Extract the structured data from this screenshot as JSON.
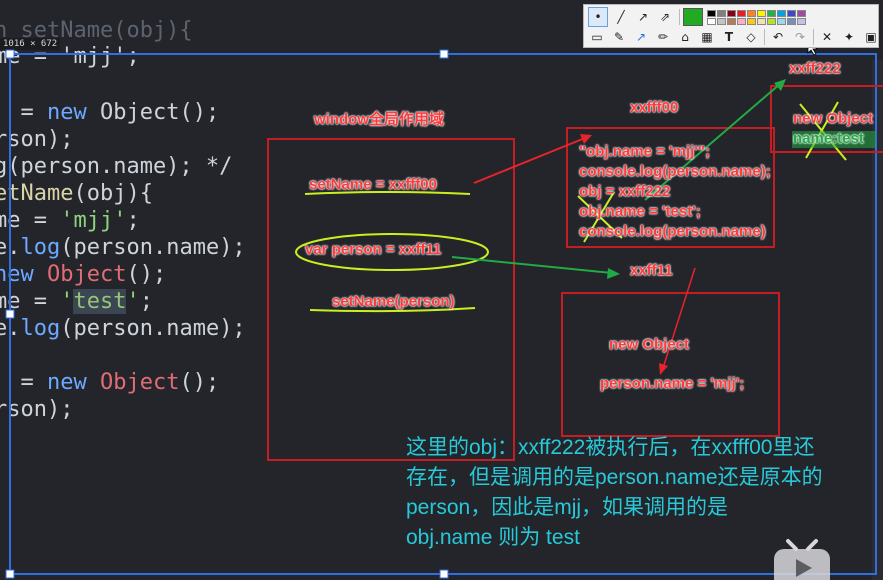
{
  "window": {
    "size_label": "1016 × 672"
  },
  "code_lines": [
    {
      "id": "l1",
      "text_parts": [
        {
          "t": "n setName(obj){",
          "c": "dim"
        }
      ]
    },
    {
      "id": "l2",
      "text_parts": [
        {
          "t": "me = 'mjj';",
          "c": ""
        }
      ]
    },
    {
      "id": "l3",
      "text_parts": [
        {
          "t": "  = ",
          "c": ""
        },
        {
          "t": "new ",
          "c": "kw"
        },
        {
          "t": "Object",
          "c": ""
        },
        {
          "t": "();",
          "c": ""
        }
      ]
    },
    {
      "id": "l4",
      "text_parts": [
        {
          "t": "rson);",
          "c": ""
        }
      ]
    },
    {
      "id": "l5",
      "text_parts": [
        {
          "t": "g(person.name); */",
          "c": ""
        }
      ]
    },
    {
      "id": "l6",
      "text_parts": [
        {
          "t": "etName",
          "c": "fn"
        },
        {
          "t": "(obj){",
          "c": ""
        }
      ]
    },
    {
      "id": "l7",
      "text_parts": [
        {
          "t": "me = ",
          "c": ""
        },
        {
          "t": "'mjj'",
          "c": "str"
        },
        {
          "t": ";",
          "c": ""
        }
      ]
    },
    {
      "id": "l8",
      "text_parts": [
        {
          "t": "e.",
          "c": ""
        },
        {
          "t": "log",
          "c": "kw"
        },
        {
          "t": "(person.name);",
          "c": ""
        }
      ]
    },
    {
      "id": "l9",
      "text_parts": [
        {
          "t": "new ",
          "c": "kw"
        },
        {
          "t": "Object",
          "c": "cls"
        },
        {
          "t": "();",
          "c": ""
        }
      ]
    },
    {
      "id": "l10",
      "text_parts": [
        {
          "t": "me = ",
          "c": ""
        },
        {
          "t": "'",
          "c": "str"
        },
        {
          "t": "test",
          "c": "sel"
        },
        {
          "t": "'",
          "c": "str"
        },
        {
          "t": ";",
          "c": ""
        }
      ]
    },
    {
      "id": "l11",
      "text_parts": [
        {
          "t": "e.",
          "c": ""
        },
        {
          "t": "log",
          "c": "kw"
        },
        {
          "t": "(person.name);",
          "c": ""
        }
      ]
    },
    {
      "id": "l12",
      "text_parts": [
        {
          "t": "  = ",
          "c": ""
        },
        {
          "t": "new ",
          "c": "kw"
        },
        {
          "t": "Object",
          "c": "cls"
        },
        {
          "t": "();",
          "c": ""
        }
      ]
    },
    {
      "id": "l13",
      "text_parts": [
        {
          "t": "rson);",
          "c": ""
        }
      ]
    }
  ],
  "annotations": {
    "scope_title": "window全局作用域",
    "set_name_assign": "setName = xxfff00",
    "var_person": "var person = xxff11",
    "set_name_call": "setName(person)",
    "addr_fff00": "xxfff00",
    "fn_body": [
      "\"obj.name = 'mjj'\";",
      "console.log(person.name);",
      "obj = xxff222",
      "obj.name = 'test';",
      "console.log(person.name)"
    ],
    "addr_ff11": "xxff11",
    "new_object_1": "new Object",
    "person_name": "person.name = 'mjj';",
    "addr_ff222": "xxff222",
    "new_object_2": "new Object",
    "name_test": "name:test"
  },
  "note_lines": [
    "这里的obj：xxff222被执行后，在xxfff00里还",
    "存在，但是调用的是person.name还是原本的",
    "person，因此是mjj，如果调用的是",
    "obj.name 则为 test"
  ],
  "toolbar": {
    "row1": [
      "dot-tool",
      "line-tool",
      "arrow-tool",
      "arrow-outline-tool"
    ],
    "row2": [
      "rect-select-tool",
      "pen-tool",
      "arrow-tool",
      "pencil-tool",
      "marker-tool",
      "blur-tool",
      "text-tool",
      "eraser-tool",
      "undo",
      "redo",
      "close",
      "pin",
      "save",
      "copy"
    ],
    "selected_color": "#22aa22",
    "palette": [
      "#000000",
      "#7f7f7f",
      "#880015",
      "#ed1c24",
      "#ff7f27",
      "#fff200",
      "#22b14c",
      "#00a2e8",
      "#3f48cc",
      "#a349a4",
      "#ffffff",
      "#c3c3c3",
      "#b97a57",
      "#ffaec9",
      "#ffc90e",
      "#efe4b0",
      "#b5e61d",
      "#99d9ea",
      "#7092be",
      "#c8bfe7"
    ]
  },
  "colors": {
    "annotation_red": "#e8232a",
    "annotation_green": "#22aa44",
    "highlight_yellow": "#c8f020",
    "selection_blue": "#2f6fe0",
    "note_cyan": "#27c9d8"
  }
}
